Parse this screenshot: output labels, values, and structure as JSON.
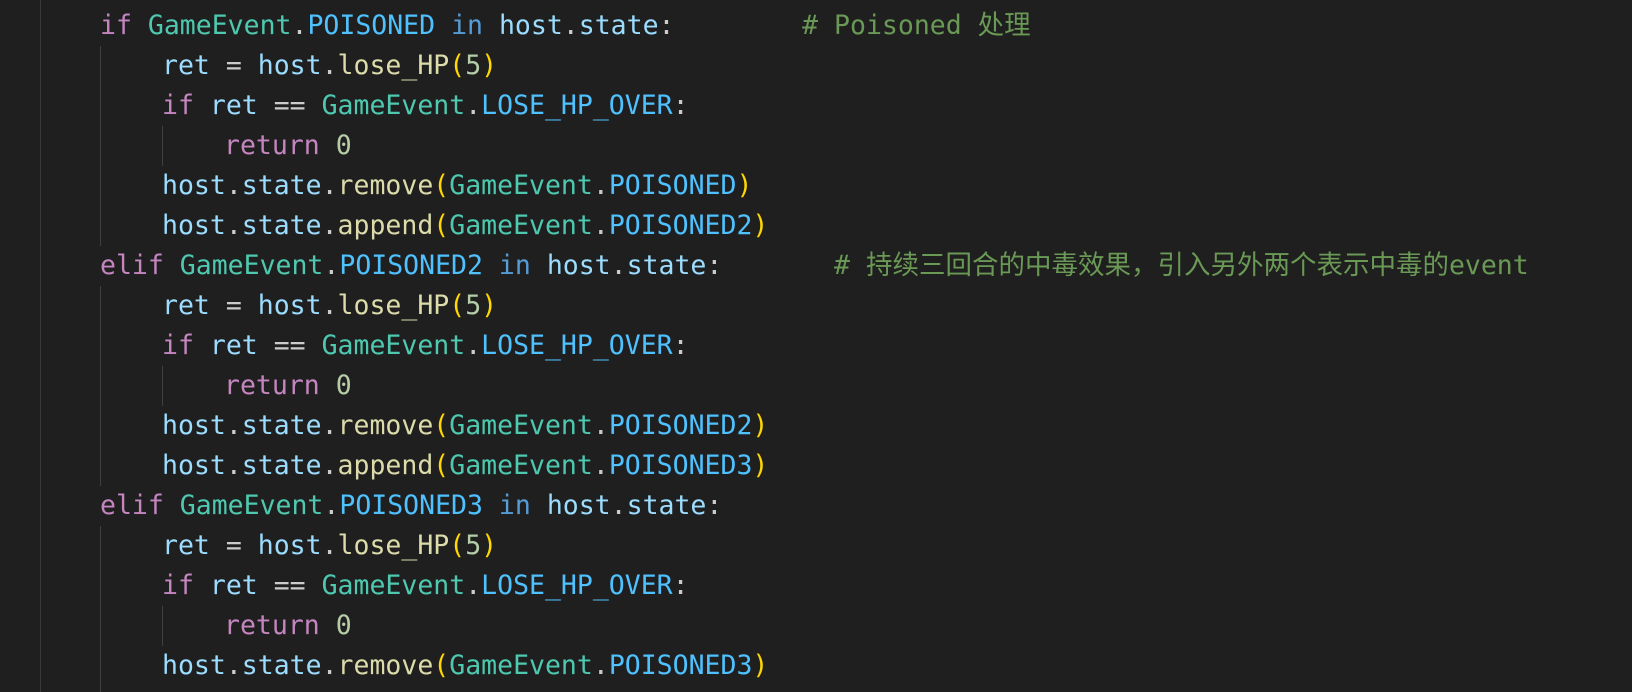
{
  "colors": {
    "background": "#1f1f1f",
    "keyword": "#c586c0",
    "class_name": "#4ec9b0",
    "constant": "#4fc1ff",
    "variable": "#9cdcfe",
    "function": "#dcdcaa",
    "number": "#b5cea8",
    "comment": "#6a9955",
    "punctuation": "#cccccc",
    "bracket": "#ffd700",
    "operator_in": "#569cd6",
    "indent_guide": "#404040"
  },
  "code_lines": [
    {
      "indent": 1,
      "tokens": [
        {
          "t": "if",
          "c": "keyword"
        },
        {
          "t": " ",
          "c": "punctuation"
        },
        {
          "t": "GameEvent",
          "c": "class_name"
        },
        {
          "t": ".",
          "c": "punctuation"
        },
        {
          "t": "POISONED",
          "c": "constant"
        },
        {
          "t": " ",
          "c": "punctuation"
        },
        {
          "t": "in",
          "c": "operator_in"
        },
        {
          "t": " ",
          "c": "punctuation"
        },
        {
          "t": "host",
          "c": "variable"
        },
        {
          "t": ".",
          "c": "punctuation"
        },
        {
          "t": "state",
          "c": "variable"
        },
        {
          "t": ":",
          "c": "punctuation"
        },
        {
          "t": "        # Poisoned 处理",
          "c": "comment"
        }
      ]
    },
    {
      "indent": 2,
      "tokens": [
        {
          "t": "ret",
          "c": "variable"
        },
        {
          "t": " = ",
          "c": "punctuation"
        },
        {
          "t": "host",
          "c": "variable"
        },
        {
          "t": ".",
          "c": "punctuation"
        },
        {
          "t": "lose_HP",
          "c": "function"
        },
        {
          "t": "(",
          "c": "bracket"
        },
        {
          "t": "5",
          "c": "number"
        },
        {
          "t": ")",
          "c": "bracket"
        }
      ]
    },
    {
      "indent": 2,
      "tokens": [
        {
          "t": "if",
          "c": "keyword"
        },
        {
          "t": " ",
          "c": "punctuation"
        },
        {
          "t": "ret",
          "c": "variable"
        },
        {
          "t": " == ",
          "c": "punctuation"
        },
        {
          "t": "GameEvent",
          "c": "class_name"
        },
        {
          "t": ".",
          "c": "punctuation"
        },
        {
          "t": "LOSE_HP_OVER",
          "c": "constant"
        },
        {
          "t": ":",
          "c": "punctuation"
        }
      ]
    },
    {
      "indent": 3,
      "tokens": [
        {
          "t": "return",
          "c": "keyword"
        },
        {
          "t": " ",
          "c": "punctuation"
        },
        {
          "t": "0",
          "c": "number"
        }
      ]
    },
    {
      "indent": 2,
      "tokens": [
        {
          "t": "host",
          "c": "variable"
        },
        {
          "t": ".",
          "c": "punctuation"
        },
        {
          "t": "state",
          "c": "variable"
        },
        {
          "t": ".",
          "c": "punctuation"
        },
        {
          "t": "remove",
          "c": "function"
        },
        {
          "t": "(",
          "c": "bracket"
        },
        {
          "t": "GameEvent",
          "c": "class_name"
        },
        {
          "t": ".",
          "c": "punctuation"
        },
        {
          "t": "POISONED",
          "c": "constant"
        },
        {
          "t": ")",
          "c": "bracket"
        }
      ]
    },
    {
      "indent": 2,
      "tokens": [
        {
          "t": "host",
          "c": "variable"
        },
        {
          "t": ".",
          "c": "punctuation"
        },
        {
          "t": "state",
          "c": "variable"
        },
        {
          "t": ".",
          "c": "punctuation"
        },
        {
          "t": "append",
          "c": "function"
        },
        {
          "t": "(",
          "c": "bracket"
        },
        {
          "t": "GameEvent",
          "c": "class_name"
        },
        {
          "t": ".",
          "c": "punctuation"
        },
        {
          "t": "POISONED2",
          "c": "constant"
        },
        {
          "t": ")",
          "c": "bracket"
        }
      ]
    },
    {
      "indent": 1,
      "tokens": [
        {
          "t": "elif",
          "c": "keyword"
        },
        {
          "t": " ",
          "c": "punctuation"
        },
        {
          "t": "GameEvent",
          "c": "class_name"
        },
        {
          "t": ".",
          "c": "punctuation"
        },
        {
          "t": "POISONED2",
          "c": "constant"
        },
        {
          "t": " ",
          "c": "punctuation"
        },
        {
          "t": "in",
          "c": "operator_in"
        },
        {
          "t": " ",
          "c": "punctuation"
        },
        {
          "t": "host",
          "c": "variable"
        },
        {
          "t": ".",
          "c": "punctuation"
        },
        {
          "t": "state",
          "c": "variable"
        },
        {
          "t": ":",
          "c": "punctuation"
        },
        {
          "t": "       # 持续三回合的中毒效果，引入另外两个表示中毒的event",
          "c": "comment"
        }
      ]
    },
    {
      "indent": 2,
      "tokens": [
        {
          "t": "ret",
          "c": "variable"
        },
        {
          "t": " = ",
          "c": "punctuation"
        },
        {
          "t": "host",
          "c": "variable"
        },
        {
          "t": ".",
          "c": "punctuation"
        },
        {
          "t": "lose_HP",
          "c": "function"
        },
        {
          "t": "(",
          "c": "bracket"
        },
        {
          "t": "5",
          "c": "number"
        },
        {
          "t": ")",
          "c": "bracket"
        }
      ]
    },
    {
      "indent": 2,
      "tokens": [
        {
          "t": "if",
          "c": "keyword"
        },
        {
          "t": " ",
          "c": "punctuation"
        },
        {
          "t": "ret",
          "c": "variable"
        },
        {
          "t": " == ",
          "c": "punctuation"
        },
        {
          "t": "GameEvent",
          "c": "class_name"
        },
        {
          "t": ".",
          "c": "punctuation"
        },
        {
          "t": "LOSE_HP_OVER",
          "c": "constant"
        },
        {
          "t": ":",
          "c": "punctuation"
        }
      ]
    },
    {
      "indent": 3,
      "tokens": [
        {
          "t": "return",
          "c": "keyword"
        },
        {
          "t": " ",
          "c": "punctuation"
        },
        {
          "t": "0",
          "c": "number"
        }
      ]
    },
    {
      "indent": 2,
      "tokens": [
        {
          "t": "host",
          "c": "variable"
        },
        {
          "t": ".",
          "c": "punctuation"
        },
        {
          "t": "state",
          "c": "variable"
        },
        {
          "t": ".",
          "c": "punctuation"
        },
        {
          "t": "remove",
          "c": "function"
        },
        {
          "t": "(",
          "c": "bracket"
        },
        {
          "t": "GameEvent",
          "c": "class_name"
        },
        {
          "t": ".",
          "c": "punctuation"
        },
        {
          "t": "POISONED2",
          "c": "constant"
        },
        {
          "t": ")",
          "c": "bracket"
        }
      ]
    },
    {
      "indent": 2,
      "tokens": [
        {
          "t": "host",
          "c": "variable"
        },
        {
          "t": ".",
          "c": "punctuation"
        },
        {
          "t": "state",
          "c": "variable"
        },
        {
          "t": ".",
          "c": "punctuation"
        },
        {
          "t": "append",
          "c": "function"
        },
        {
          "t": "(",
          "c": "bracket"
        },
        {
          "t": "GameEvent",
          "c": "class_name"
        },
        {
          "t": ".",
          "c": "punctuation"
        },
        {
          "t": "POISONED3",
          "c": "constant"
        },
        {
          "t": ")",
          "c": "bracket"
        }
      ]
    },
    {
      "indent": 1,
      "tokens": [
        {
          "t": "elif",
          "c": "keyword"
        },
        {
          "t": " ",
          "c": "punctuation"
        },
        {
          "t": "GameEvent",
          "c": "class_name"
        },
        {
          "t": ".",
          "c": "punctuation"
        },
        {
          "t": "POISONED3",
          "c": "constant"
        },
        {
          "t": " ",
          "c": "punctuation"
        },
        {
          "t": "in",
          "c": "operator_in"
        },
        {
          "t": " ",
          "c": "punctuation"
        },
        {
          "t": "host",
          "c": "variable"
        },
        {
          "t": ".",
          "c": "punctuation"
        },
        {
          "t": "state",
          "c": "variable"
        },
        {
          "t": ":",
          "c": "punctuation"
        }
      ]
    },
    {
      "indent": 2,
      "tokens": [
        {
          "t": "ret",
          "c": "variable"
        },
        {
          "t": " = ",
          "c": "punctuation"
        },
        {
          "t": "host",
          "c": "variable"
        },
        {
          "t": ".",
          "c": "punctuation"
        },
        {
          "t": "lose_HP",
          "c": "function"
        },
        {
          "t": "(",
          "c": "bracket"
        },
        {
          "t": "5",
          "c": "number"
        },
        {
          "t": ")",
          "c": "bracket"
        }
      ]
    },
    {
      "indent": 2,
      "tokens": [
        {
          "t": "if",
          "c": "keyword"
        },
        {
          "t": " ",
          "c": "punctuation"
        },
        {
          "t": "ret",
          "c": "variable"
        },
        {
          "t": " == ",
          "c": "punctuation"
        },
        {
          "t": "GameEvent",
          "c": "class_name"
        },
        {
          "t": ".",
          "c": "punctuation"
        },
        {
          "t": "LOSE_HP_OVER",
          "c": "constant"
        },
        {
          "t": ":",
          "c": "punctuation"
        }
      ]
    },
    {
      "indent": 3,
      "tokens": [
        {
          "t": "return",
          "c": "keyword"
        },
        {
          "t": " ",
          "c": "punctuation"
        },
        {
          "t": "0",
          "c": "number"
        }
      ]
    },
    {
      "indent": 2,
      "tokens": [
        {
          "t": "host",
          "c": "variable"
        },
        {
          "t": ".",
          "c": "punctuation"
        },
        {
          "t": "state",
          "c": "variable"
        },
        {
          "t": ".",
          "c": "punctuation"
        },
        {
          "t": "remove",
          "c": "function"
        },
        {
          "t": "(",
          "c": "bracket"
        },
        {
          "t": "GameEvent",
          "c": "class_name"
        },
        {
          "t": ".",
          "c": "punctuation"
        },
        {
          "t": "POISONED3",
          "c": "constant"
        },
        {
          "t": ")",
          "c": "bracket"
        }
      ]
    }
  ]
}
